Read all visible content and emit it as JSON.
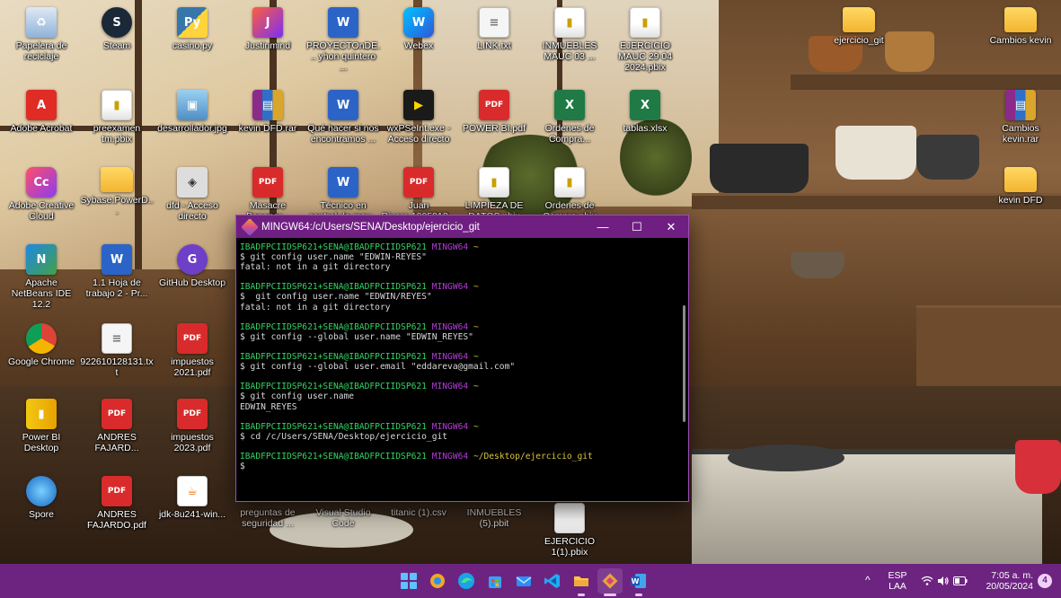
{
  "desktop": {
    "icons": [
      {
        "label": "Papelera de reciclaje",
        "glyph": "♻",
        "icon": "recycle-bin-icon"
      },
      {
        "label": "Steam",
        "glyph": "S",
        "icon": "steam-icon"
      },
      {
        "label": "casino.py",
        "glyph": "Py",
        "icon": "python-file-icon"
      },
      {
        "label": "Justinmind",
        "glyph": "J",
        "icon": "justinmind-icon"
      },
      {
        "label": "PROYECTOnDE... yhon quintero ...",
        "glyph": "W",
        "icon": "word-document-icon"
      },
      {
        "label": "Webex",
        "glyph": "W",
        "icon": "webex-icon"
      },
      {
        "label": "LINK.txt",
        "glyph": "≡",
        "icon": "text-file-icon"
      },
      {
        "label": "INMUEBLES MAUC 03 ...",
        "glyph": "▮",
        "icon": "pbix-file-icon"
      },
      {
        "label": "EJERCICIO MAUC 29 04 2024.pbix",
        "glyph": "▮",
        "icon": "pbix-file-icon"
      },
      {
        "label": "ejercicio_git",
        "glyph": "",
        "icon": "folder-icon"
      },
      {
        "label": "Cambios kevin",
        "glyph": "",
        "icon": "folder-icon"
      },
      {
        "label": "Adobe Acrobat",
        "glyph": "A",
        "icon": "adobe-acrobat-icon"
      },
      {
        "label": "preexamen tm.pbix",
        "glyph": "▮",
        "icon": "pbix-file-icon"
      },
      {
        "label": "desarrollador.jpg",
        "glyph": "▣",
        "icon": "image-file-icon"
      },
      {
        "label": "kevin DFD.rar",
        "glyph": "▤",
        "icon": "rar-archive-icon"
      },
      {
        "label": "Qué hacer si nos encontramos ...",
        "glyph": "W",
        "icon": "word-document-icon"
      },
      {
        "label": "wxPSeInt.exe - Acceso directo",
        "glyph": "▶",
        "icon": "pseint-icon"
      },
      {
        "label": "POWER BI.pdf",
        "glyph": "PDF",
        "icon": "pdf-file-icon"
      },
      {
        "label": "Ordenes de Compra...",
        "glyph": "X",
        "icon": "excel-file-icon"
      },
      {
        "label": "tablas.xlsx",
        "glyph": "X",
        "icon": "excel-file-icon"
      },
      {
        "label": "Cambios kevin.rar",
        "glyph": "▤",
        "icon": "rar-archive-icon"
      },
      {
        "label": "Adobe Creative Cloud",
        "glyph": "Cc",
        "icon": "creative-cloud-icon"
      },
      {
        "label": "Sybase.PowerD...",
        "glyph": "",
        "icon": "folder-icon"
      },
      {
        "label": "dfd - Acceso directo",
        "glyph": "◈",
        "icon": "dfd-shortcut-icon"
      },
      {
        "label": "Masacre Bananer...",
        "glyph": "PDF",
        "icon": "pdf-file-icon"
      },
      {
        "label": "Técnico en control de mov...",
        "glyph": "W",
        "icon": "word-document-icon"
      },
      {
        "label": "Juan Rivera.1005912...",
        "glyph": "PDF",
        "icon": "pdf-file-icon"
      },
      {
        "label": "LIMPIEZA DE DATOS.pbix",
        "glyph": "▮",
        "icon": "pbix-file-icon"
      },
      {
        "label": "Ordenes de Compra.pbix",
        "glyph": "▮",
        "icon": "pbix-file-icon"
      },
      {
        "label": "kevin DFD",
        "glyph": "",
        "icon": "folder-icon"
      },
      {
        "label": "Apache NetBeans IDE 12.2",
        "glyph": "N",
        "icon": "netbeans-icon"
      },
      {
        "label": "1.1 Hoja de trabajo 2 - Pr...",
        "glyph": "W",
        "icon": "word-document-icon"
      },
      {
        "label": "GitHub Desktop",
        "glyph": "G",
        "icon": "github-desktop-icon"
      },
      {
        "label": "Google Chrome",
        "glyph": "",
        "icon": "chrome-icon"
      },
      {
        "label": "922610128131.txt",
        "glyph": "≡",
        "icon": "text-file-icon"
      },
      {
        "label": "impuestos 2021.pdf",
        "glyph": "PDF",
        "icon": "pdf-file-icon"
      },
      {
        "label": "Power BI Desktop",
        "glyph": "▮",
        "icon": "power-bi-icon"
      },
      {
        "label": "ANDRES FAJARD...",
        "glyph": "PDF",
        "icon": "pdf-file-icon"
      },
      {
        "label": "impuestos 2023.pdf",
        "glyph": "PDF",
        "icon": "pdf-file-icon"
      },
      {
        "label": "Spore",
        "glyph": "",
        "icon": "spore-icon"
      },
      {
        "label": "ANDRES FAJARDO.pdf",
        "glyph": "PDF",
        "icon": "pdf-file-icon"
      },
      {
        "label": "jdk-8u241-win...",
        "glyph": "☕",
        "icon": "java-installer-icon"
      },
      {
        "label": "preguntas de seguridad ...",
        "glyph": "",
        "icon": "file-icon"
      },
      {
        "label": "Visual Studio Code",
        "glyph": "",
        "icon": "vscode-icon"
      },
      {
        "label": "titanic (1).csv",
        "glyph": "",
        "icon": "csv-file-icon"
      },
      {
        "label": "INMUEBLES (5).pbit",
        "glyph": "",
        "icon": "pbit-file-icon"
      },
      {
        "label": "EJERCICIO 1(1).pbix",
        "glyph": "",
        "icon": "pbix-file-icon"
      }
    ]
  },
  "terminal": {
    "title": "MINGW64:/c/Users/SENA/Desktop/ejercicio_git",
    "minimize": "—",
    "maximize": "☐",
    "close": "✕",
    "prompt_user": "IBADFPCIIDSP621+SENA@IBADFPCIIDSP621",
    "prompt_env": "MINGW64",
    "blocks": [
      {
        "path": "~",
        "lines": [
          "$ git config user.name \"EDWIN-REYES\"",
          "fatal: not in a git directory"
        ]
      },
      {
        "path": "~",
        "lines": [
          "$  git config user.name \"EDWIN/REYES\"",
          "fatal: not in a git directory"
        ]
      },
      {
        "path": "~",
        "lines": [
          "$ git config --global user.name \"EDWIN_REYES\""
        ]
      },
      {
        "path": "~",
        "lines": [
          "$ git config --global user.email \"eddareva@gmail.com\""
        ]
      },
      {
        "path": "~",
        "lines": [
          "$ git config user.name",
          "EDWIN_REYES"
        ]
      },
      {
        "path": "~",
        "lines": [
          "$ cd /c/Users/SENA/Desktop/ejercicio_git"
        ]
      },
      {
        "path": "~/Desktop/ejercicio_git",
        "lines": [
          "$"
        ]
      }
    ]
  },
  "taskbar": {
    "apps": [
      "start-icon",
      "search-icon",
      "edge-icon",
      "store-icon",
      "mail-icon",
      "vscode-icon",
      "file-explorer-icon",
      "git-bash-icon",
      "word-icon"
    ],
    "tray": {
      "chevron": "^",
      "language": "ESP",
      "layout": "LAA",
      "time": "7:05 a. m.",
      "date": "20/05/2024",
      "notifications": "4"
    }
  }
}
